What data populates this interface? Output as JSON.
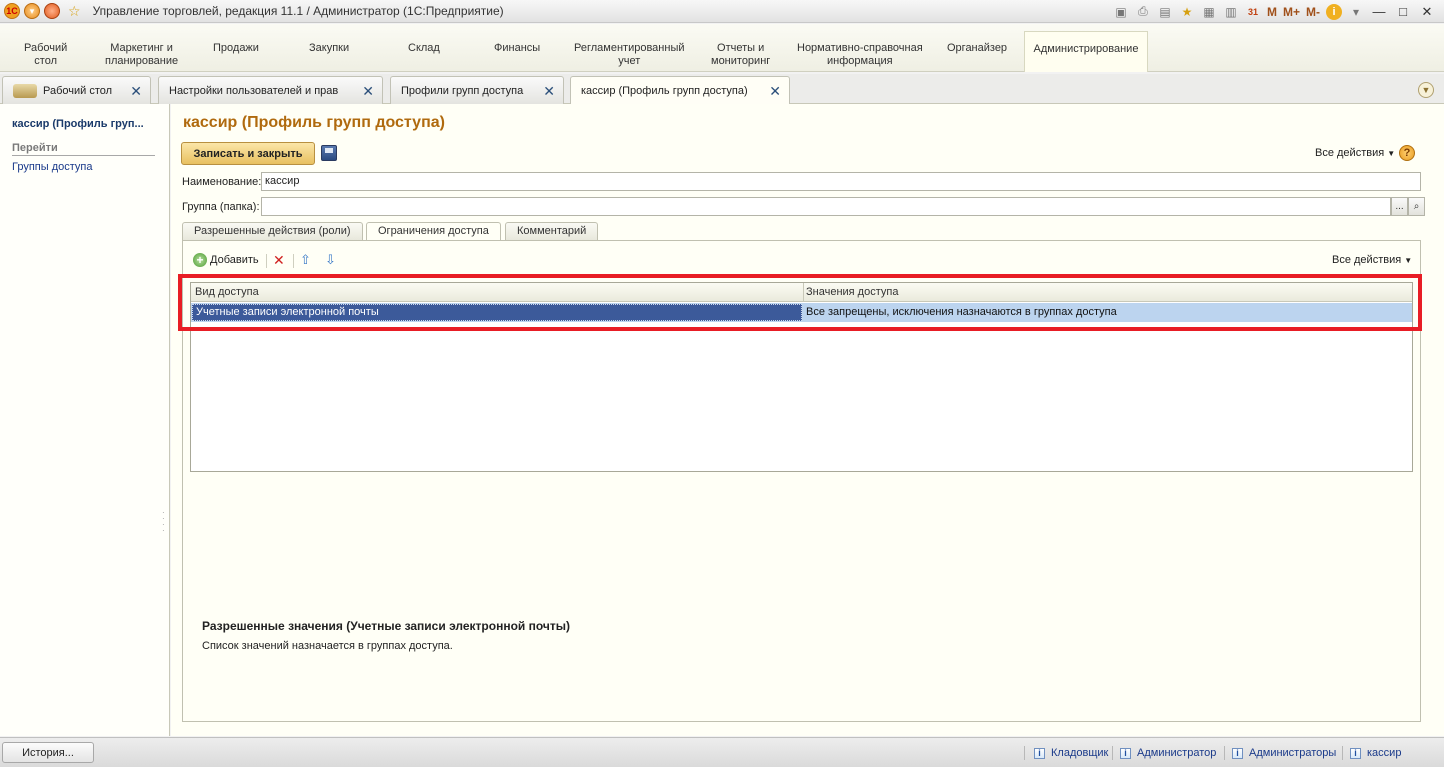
{
  "window": {
    "title": "Управление торговлей, редакция 11.1 / Администратор  (1С:Предприятие)",
    "logo_text": "1С",
    "m_buttons": [
      "M",
      "M+",
      "M-"
    ],
    "calendar_day": "31"
  },
  "sections": [
    {
      "label": "Рабочий\nстол"
    },
    {
      "label": "Маркетинг и\nпланирование"
    },
    {
      "label": "Продажи"
    },
    {
      "label": "Закупки"
    },
    {
      "label": "Склад"
    },
    {
      "label": "Финансы"
    },
    {
      "label": "Регламентированный\nучет"
    },
    {
      "label": "Отчеты и\nмониторинг"
    },
    {
      "label": "Нормативно-справочная\nинформация"
    },
    {
      "label": "Органайзер"
    },
    {
      "label": "Администрирование"
    }
  ],
  "open_tabs": [
    {
      "label": "Рабочий стол"
    },
    {
      "label": "Настройки пользователей и прав"
    },
    {
      "label": "Профили групп доступа"
    },
    {
      "label": "кассир (Профиль групп доступа)"
    }
  ],
  "nav": {
    "title": "кассир (Профиль груп...",
    "section": "Перейти",
    "link": "Группы доступа"
  },
  "form": {
    "title": "кассир (Профиль групп доступа)",
    "save_close": "Записать и закрыть",
    "all_actions": "Все действия",
    "help": "?",
    "name_label": "Наименование:",
    "name_value": "кассир",
    "group_label": "Группа (папка):",
    "group_value": "",
    "select_btn": "...",
    "tabs": [
      "Разрешенные действия (роли)",
      "Ограничения доступа",
      "Комментарий"
    ],
    "add_label": "Добавить",
    "table": {
      "columns": [
        "Вид доступа",
        "Значения доступа"
      ],
      "rows": [
        [
          "Учетные записи электронной почты",
          "Все запрещены, исключения назначаются в группах доступа"
        ]
      ]
    },
    "allowed_title": "Разрешенные значения (Учетные записи электронной почты)",
    "allowed_text": "Список значений назначается в группах доступа."
  },
  "statusbar": {
    "history": "История...",
    "items": [
      "Кладовщик",
      "Администратор",
      "Администраторы",
      "кассир"
    ]
  },
  "colors": {
    "accent_title": "#b06a0e",
    "highlight_frame": "#e81d25",
    "selection": "#3c5a9a"
  }
}
